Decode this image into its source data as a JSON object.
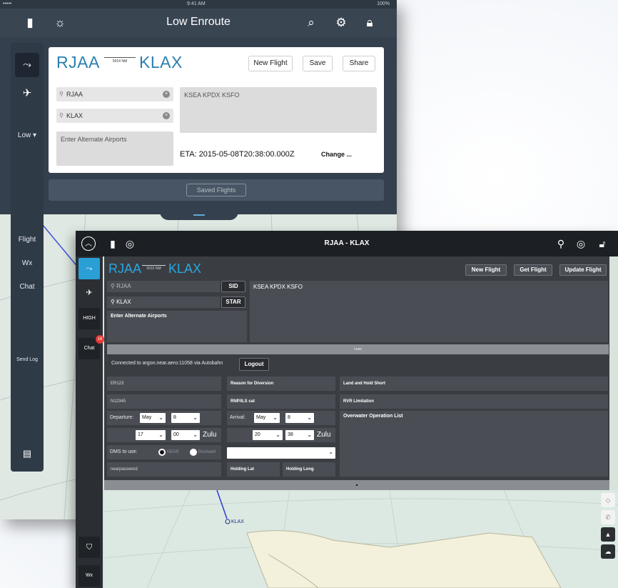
{
  "ipad": {
    "status": {
      "carrier": "•••••",
      "time": "9:41 AM",
      "battery": "100%"
    },
    "title": "Low Enroute",
    "sidebar": {
      "low_label": "Low ▾",
      "flight": "Flight",
      "wx": "Wx",
      "chat": "Chat",
      "send_log": "Send Log"
    },
    "route": {
      "from": "RJAA",
      "to": "KLAX",
      "distance": "5014 NM"
    },
    "buttons": {
      "new_flight": "New Flight",
      "save": "Save",
      "share": "Share"
    },
    "origin_value": "RJAA",
    "destination_value": "KLAX",
    "alternate_placeholder": "Enter Alternate Airports",
    "waypoints": "KSEA KPDX KSFO",
    "eta": "ETA: 2015-05-08T20:38:00.000Z",
    "change_label": "Change ...",
    "saved_flights": "Saved Flights"
  },
  "win": {
    "title": "RJAA - KLAX",
    "route": {
      "from": "RJAA",
      "to": "KLAX",
      "distance": "5015 NM"
    },
    "buttons": {
      "new_flight": "New Flight",
      "get_flight": "Get Flight",
      "update_flight": "Update Flight",
      "sid": "SID",
      "star": "STAR",
      "logout": "Logout"
    },
    "origin_placeholder": "RJAA",
    "destination_value": "KLAX",
    "alternate_placeholder": "Enter Alternate Airports",
    "waypoints": "KSEA KPDX KSFO",
    "less": "Less",
    "connection": "Connected to argon.near.aero:11058 via Autobahn",
    "sidebar": {
      "high": "HIGH",
      "chat": "Chat",
      "chat_badge": "16",
      "wx": "Wx"
    },
    "fields": {
      "flight_id": "ER123",
      "tail": "N12345",
      "reason": "Reason for Diversion",
      "rnp": "RNP/ILS cat",
      "land_hold": "Land and Hold Short",
      "rvr": "RVR Limitation",
      "overwater": "Overwater Operation List",
      "password": "nearpassword",
      "holding_lat": "Holding Lat",
      "holding_long": "Holding Long"
    },
    "departure": {
      "label": "Departure:",
      "month": "May",
      "day": "8",
      "hour": "17",
      "minute": "00",
      "zulu": "Zulu"
    },
    "arrival": {
      "label": "Arrival:",
      "month": "May",
      "day": "8",
      "hour": "20",
      "minute": "38",
      "zulu": "Zulu"
    },
    "dms": {
      "label": "DMS to use:",
      "opt1": "NEAR",
      "opt2": "Rockwell"
    },
    "map_label": "KLAX"
  }
}
